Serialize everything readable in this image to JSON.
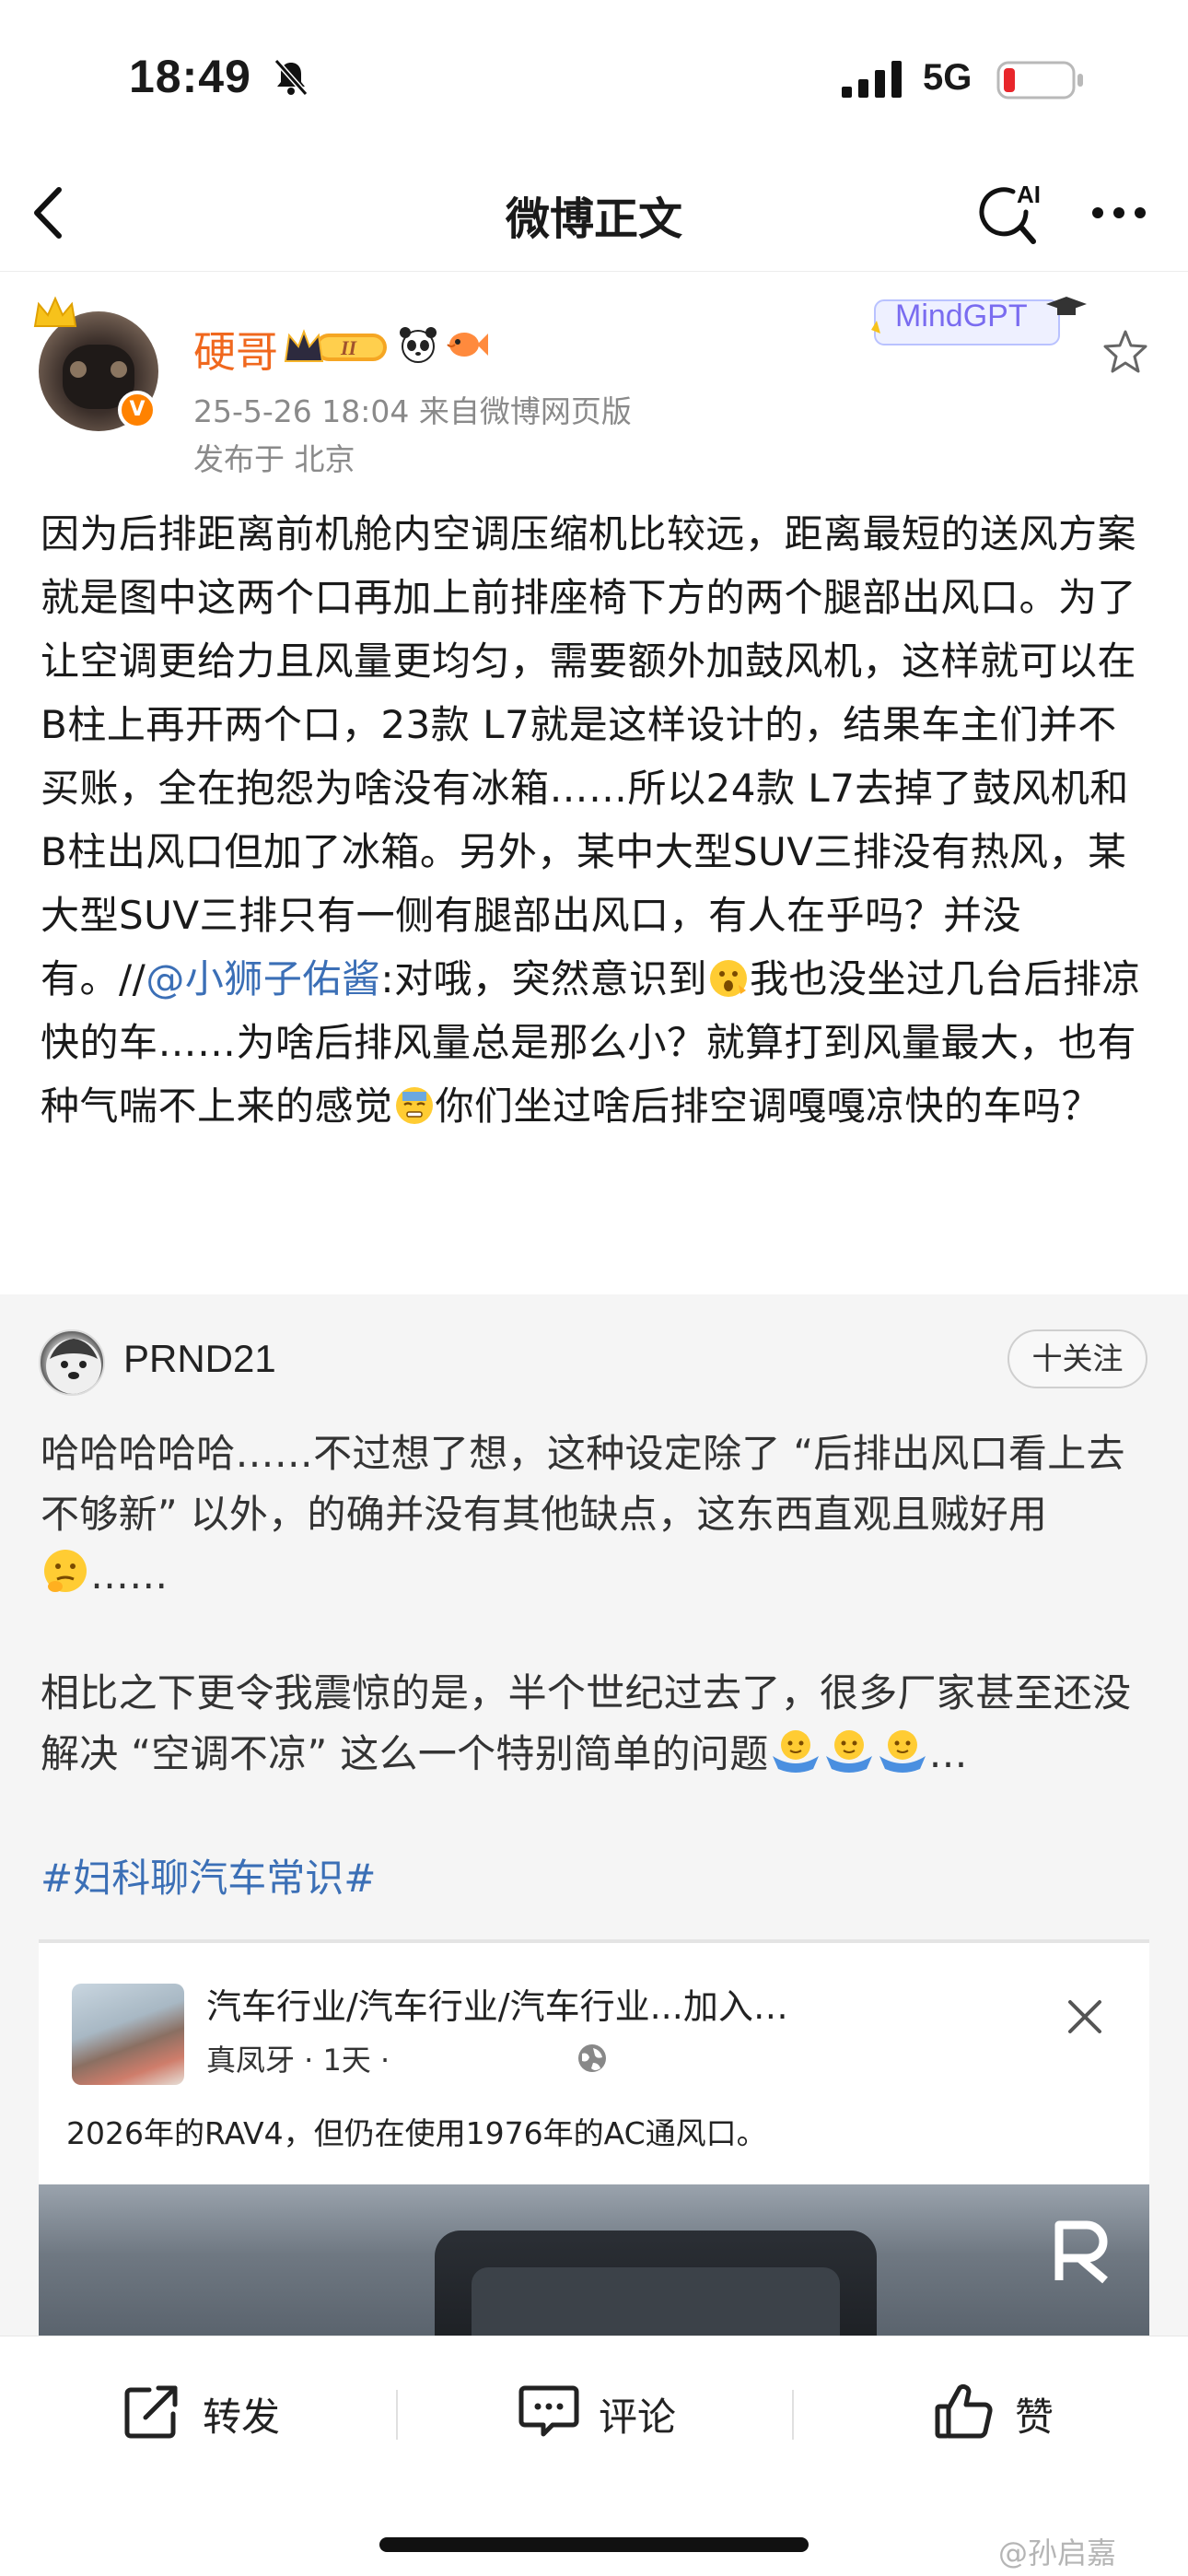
{
  "status_bar": {
    "time": "18:49",
    "network": "5G"
  },
  "nav": {
    "title": "微博正文",
    "ai_label": "AI"
  },
  "author": {
    "name": "硬哥",
    "level": "II",
    "meta": "25-5-26 18:04  来自微博网页版",
    "location": "发布于 北京",
    "badge_label": "MindGPT"
  },
  "post": {
    "text_part1": "因为后排距离前机舱内空调压缩机比较远，距离最短的送风方案就是图中这两个口再加上前排座椅下方的两个腿部出风口。为了让空调更给力且风量更均匀，需要额外加鼓风机，这样就可以在B柱上再开两个口，23款 L7就是这样设计的，结果车主们并不买账，全在抱怨为啥没有冰箱……所以24款 L7去掉了鼓风机和B柱出风口但加了冰箱。另外，某中大型SUV三排没有热风，某大型SUV三排只有一侧有腿部出风口，有人在乎吗？并没有。//",
    "mention": "@小狮子佑酱",
    "text_part2": ":对哦，突然意识到",
    "text_part3": "我也没坐过几台后排凉快的车……为啥后排风量总是那么小？就算打到风量最大，也有种气喘不上来的感觉",
    "text_part4": "你们坐过啥后排空调嘎嘎凉快的车吗？"
  },
  "repost": {
    "author": "PRND21",
    "follow_label": "十关注",
    "paragraph1": "哈哈哈哈哈……不过想了想，这种设定除了 “后排出风口看上去不够新” 以外，的确并没有其他缺点，这东西直观且贼好用",
    "paragraph1_tail": "……",
    "paragraph2": "相比之下更令我震惊的是，半个世纪过去了，很多厂家甚至还没解决 “空调不凉” 这么一个特别简单的问题",
    "paragraph2_tail": "…",
    "topic": "#妇科聊汽车常识#",
    "card": {
      "title": "汽车行业/汽车行业/汽车行业...加入…",
      "source": "真凤牙 · 1天 ·",
      "caption": "2026年的RAV4，但仍在使用1976年的AC通风口。"
    }
  },
  "toolbar": {
    "repost": "转发",
    "comment": "评论",
    "like": "赞"
  },
  "watermark": "@孙启嘉",
  "colors": {
    "accent_orange": "#f0681e",
    "link_blue": "#3b6fb6",
    "mindgpt_purple": "#7a6cf0"
  }
}
